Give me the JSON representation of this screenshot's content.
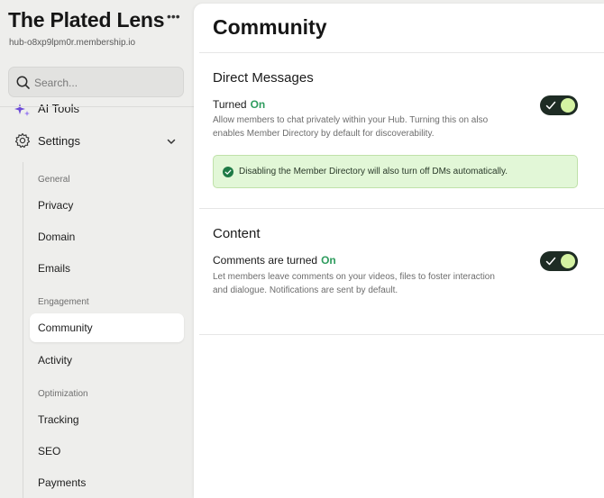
{
  "sidebar": {
    "brand_title": "The Plated Lens",
    "brand_more": "•••",
    "brand_url": "hub-o8xp9lpm0r.membership.io",
    "search": {
      "placeholder": "Search..."
    },
    "ai_tools_label": "AI Tools",
    "settings_label": "Settings",
    "groups": {
      "general": "General",
      "engagement": "Engagement",
      "optimization": "Optimization"
    },
    "items": {
      "privacy": "Privacy",
      "domain": "Domain",
      "emails": "Emails",
      "community": "Community",
      "activity": "Activity",
      "tracking": "Tracking",
      "seo": "SEO",
      "payments": "Payments"
    },
    "active_item": "community"
  },
  "main": {
    "title": "Community",
    "direct_messages": {
      "section_title": "Direct Messages",
      "setting_label": "Turned",
      "state": "On",
      "description": "Allow members to chat privately within your Hub. Turning this on also enables Member Directory by default for discoverability.",
      "enabled": true,
      "notice": "Disabling the Member Directory will also turn off DMs automatically."
    },
    "content": {
      "section_title": "Content",
      "setting_label": "Comments are turned",
      "state": "On",
      "description": "Let members leave comments on your videos, files to foster interaction and dialogue. Notifications are sent by default.",
      "enabled": true
    }
  },
  "colors": {
    "accent_on": "#2e9c5e",
    "toggle_track": "#1e2c24",
    "toggle_knob": "#d4f2a2",
    "notice_bg": "#e2f7d7"
  },
  "icons": {
    "brand_more": "more-dots-icon",
    "search": "search-icon",
    "ai_tools": "sparkle-icon",
    "settings": "gear-icon",
    "settings_expand": "chevron-down-icon",
    "toggle_check": "check-icon",
    "notice": "check-circle-icon"
  }
}
